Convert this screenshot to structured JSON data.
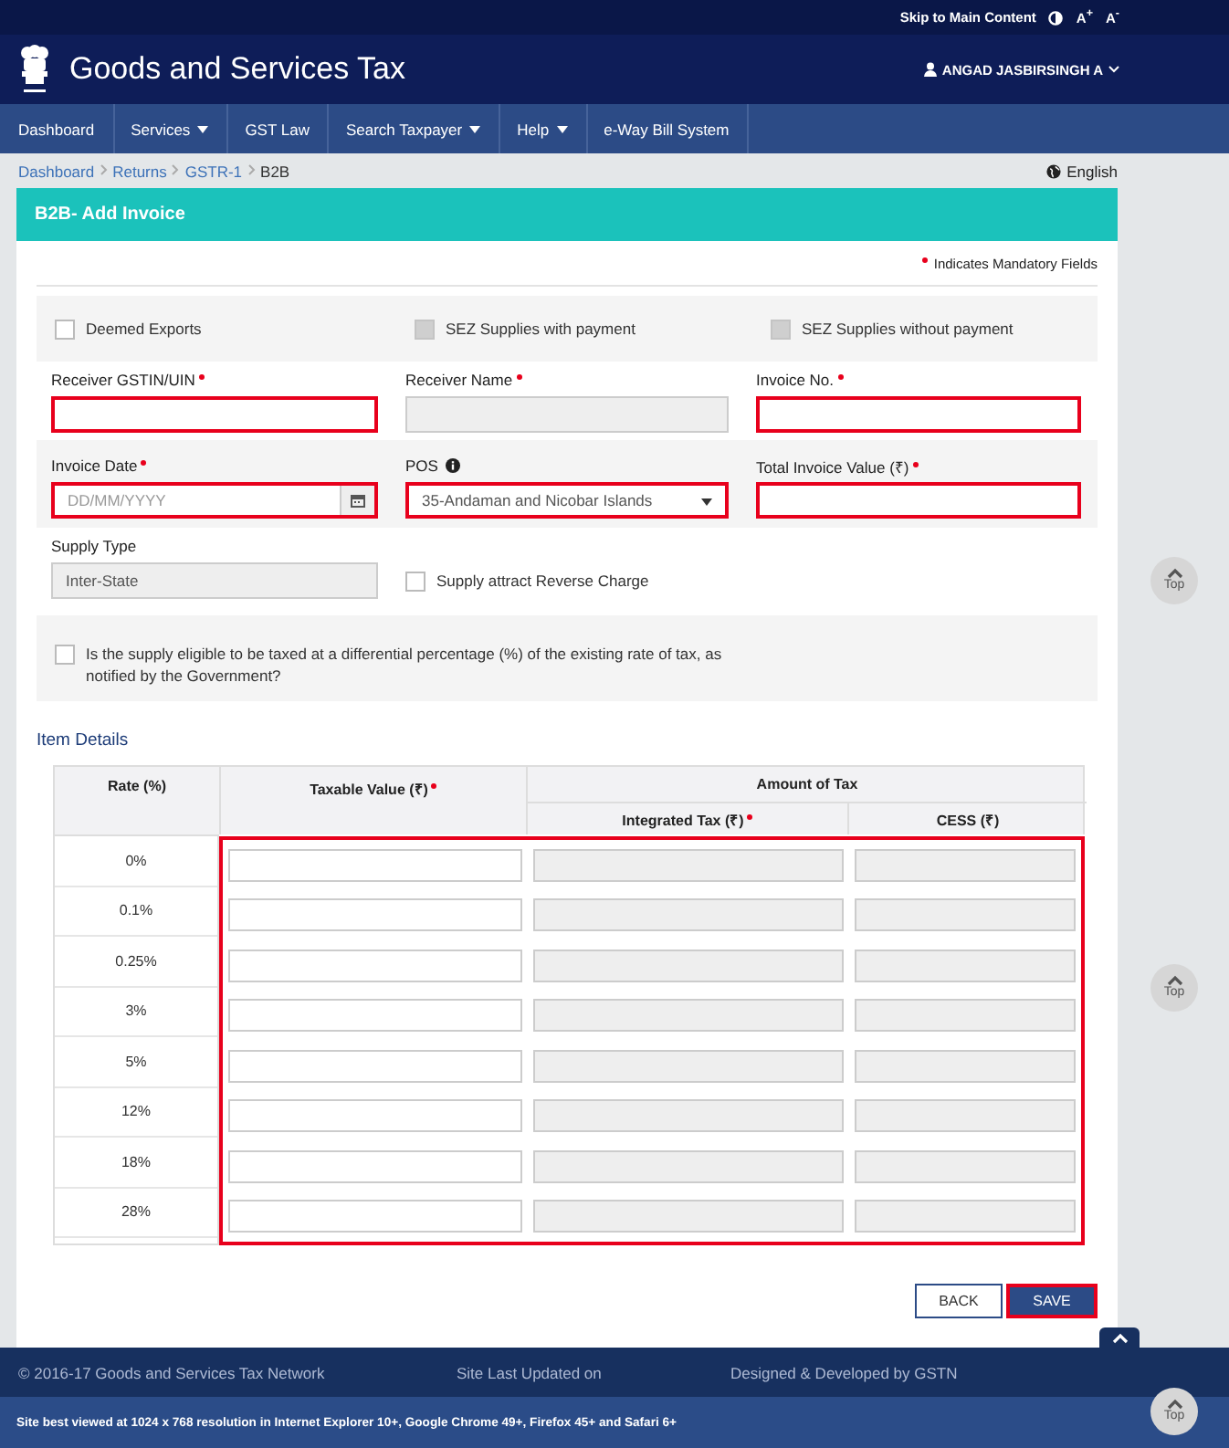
{
  "top_links": {
    "skip": "Skip to Main Content",
    "font_up": "A$^{+}$",
    "font_down": "A$^{-}$"
  },
  "header": {
    "title": "Goods and Services Tax",
    "user": "ANGAD JASBIRSINGH A"
  },
  "nav": [
    {
      "label": "Dashboard",
      "has_menu": false
    },
    {
      "label": "Services",
      "has_menu": true
    },
    {
      "label": "GST Law",
      "has_menu": false
    },
    {
      "label": "Search Taxpayer",
      "has_menu": true
    },
    {
      "label": "Help",
      "has_menu": true
    },
    {
      "label": "e-Way Bill System",
      "has_menu": false
    }
  ],
  "breadcrumb": [
    {
      "label": "Dashboard",
      "current": false
    },
    {
      "label": "Returns",
      "current": false
    },
    {
      "label": "GSTR-1",
      "current": false
    },
    {
      "label": "B2B",
      "current": true
    }
  ],
  "language": "English",
  "card_title": "B2B- Add Invoice",
  "mandatory_note": "Indicates Mandatory Fields",
  "options": [
    {
      "label": "Deemed Exports",
      "checked": false,
      "disabled": false
    },
    {
      "label": "SEZ Supplies with payment",
      "checked": false,
      "disabled": true
    },
    {
      "label": "SEZ Supplies without payment",
      "checked": false,
      "disabled": true
    }
  ],
  "field_rows": [
    {
      "shaded": false,
      "fields": [
        {
          "kind": "text",
          "label": "Receiver GSTIN/UIN",
          "required": true,
          "error": true,
          "disabled": false
        },
        {
          "kind": "text",
          "label": "Receiver Name",
          "required": true,
          "error": false,
          "disabled": true
        },
        {
          "kind": "text",
          "label": "Invoice No.",
          "required": true,
          "error": true,
          "disabled": false
        }
      ]
    },
    {
      "shaded": true,
      "fields": [
        {
          "kind": "date",
          "label": "Invoice Date",
          "required": true,
          "error": true,
          "disabled": false,
          "placeholder": "DD/MM/YYYY"
        },
        {
          "kind": "select",
          "label": "POS",
          "info": true,
          "required": false,
          "error": true,
          "disabled": false,
          "value": "35-Andaman and Nicobar Islands"
        },
        {
          "kind": "text",
          "label": "Total Invoice Value (₹)",
          "required": true,
          "error": true,
          "disabled": false
        }
      ]
    },
    {
      "shaded": false,
      "fields": [
        {
          "kind": "text",
          "label": "Supply Type",
          "required": false,
          "error": false,
          "disabled": true,
          "value": "Inter-State"
        },
        {
          "kind": "checkbox",
          "label": "Supply attract Reverse Charge",
          "checked": false
        }
      ]
    }
  ],
  "differential": {
    "label": "Is the supply eligible to be taxed at a differential percentage (%) of the existing rate of tax, as notified by the Government?",
    "checked": false
  },
  "item_details": {
    "title": "Item Details",
    "rate_header": "Rate (%)",
    "value_column": {
      "label": "Taxable Value (₹)",
      "required": true,
      "disabled": false
    },
    "tax_group": "Amount of Tax",
    "tax_columns": [
      {
        "label": "Integrated Tax (₹)",
        "required": true,
        "disabled": true
      },
      {
        "label": "CESS (₹)",
        "required": false,
        "disabled": true
      }
    ],
    "error": true,
    "rows": [
      "0%",
      "0.1%",
      "0.25%",
      "3%",
      "5%",
      "12%",
      "18%",
      "28%"
    ]
  },
  "buttons": [
    {
      "label": "BACK",
      "kind": "secondary"
    },
    {
      "label": "SAVE",
      "kind": "primary"
    }
  ],
  "footer": [
    "© 2016-17 Goods and Services Tax Network",
    "Site Last Updated on",
    "Designed & Developed by GSTN"
  ],
  "bottom_note": "Site best viewed at 1024 x 768 resolution in Internet Explorer 10+, Google Chrome 49+, Firefox 45+ and Safari 6+",
  "top_buttons": [
    "Top",
    "Top",
    "Top"
  ]
}
